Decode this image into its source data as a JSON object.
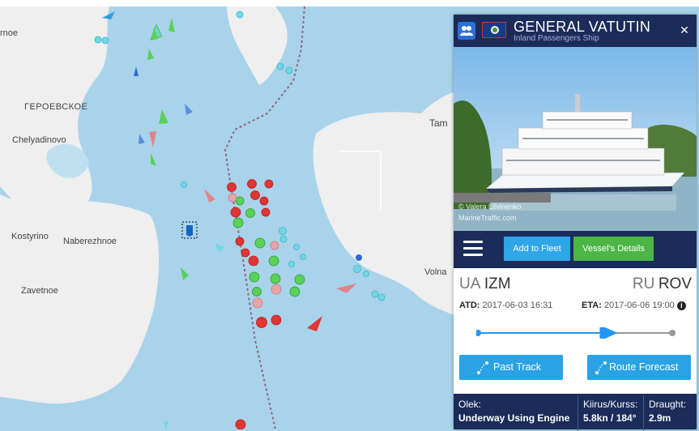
{
  "map": {
    "places": [
      "rnoe",
      "ГЕРОЕВСКОЕ",
      "Chelyadinovo",
      "Kostyrino",
      "Naberezhnoe",
      "Zavetnoe",
      "Tam",
      "Volna"
    ],
    "colors": {
      "water": "#a9d3ea",
      "land": "#efefef",
      "tanker_red": "#e03535",
      "cargo_green": "#58d258",
      "tug_cyan": "#6fd9e8",
      "passenger_blue": "#2f6bd8",
      "pleasure_pink": "#e0848b",
      "selected_vessel": "#1565c0"
    }
  },
  "vessel": {
    "name": "GENERAL VATUTIN",
    "type": "Inland Passengers Ship",
    "flag": "belize-flag",
    "photo_credit_line1": "© Valera Litvinenko",
    "photo_credit_line2": "MarineTraffic.com"
  },
  "toolbar": {
    "menu_icon": "hamburger-icon",
    "add_to_fleet_label": "Add to Fleet",
    "vessel_details_label": "Vessel's Details"
  },
  "voyage": {
    "departure_country": "UA",
    "departure_port": "IZM",
    "arrival_country": "RU",
    "arrival_port": "ROV",
    "atd_label": "ATD:",
    "atd_value": "2017-06-03 16:31",
    "eta_label": "ETA:",
    "eta_value": "2017-06-06 19:00",
    "progress": 0.71
  },
  "actions": {
    "past_track_label": "Past Track",
    "route_forecast_label": "Route Forecast"
  },
  "status": {
    "status_key": "Olek:",
    "status_value": "Underway Using Engine",
    "speed_key": "Kiirus/Kurss:",
    "speed_value": "5.8kn / 184°",
    "draught_key": "Draught:",
    "draught_value": "2.9m"
  },
  "panel": {
    "close_icon": "close-icon"
  }
}
